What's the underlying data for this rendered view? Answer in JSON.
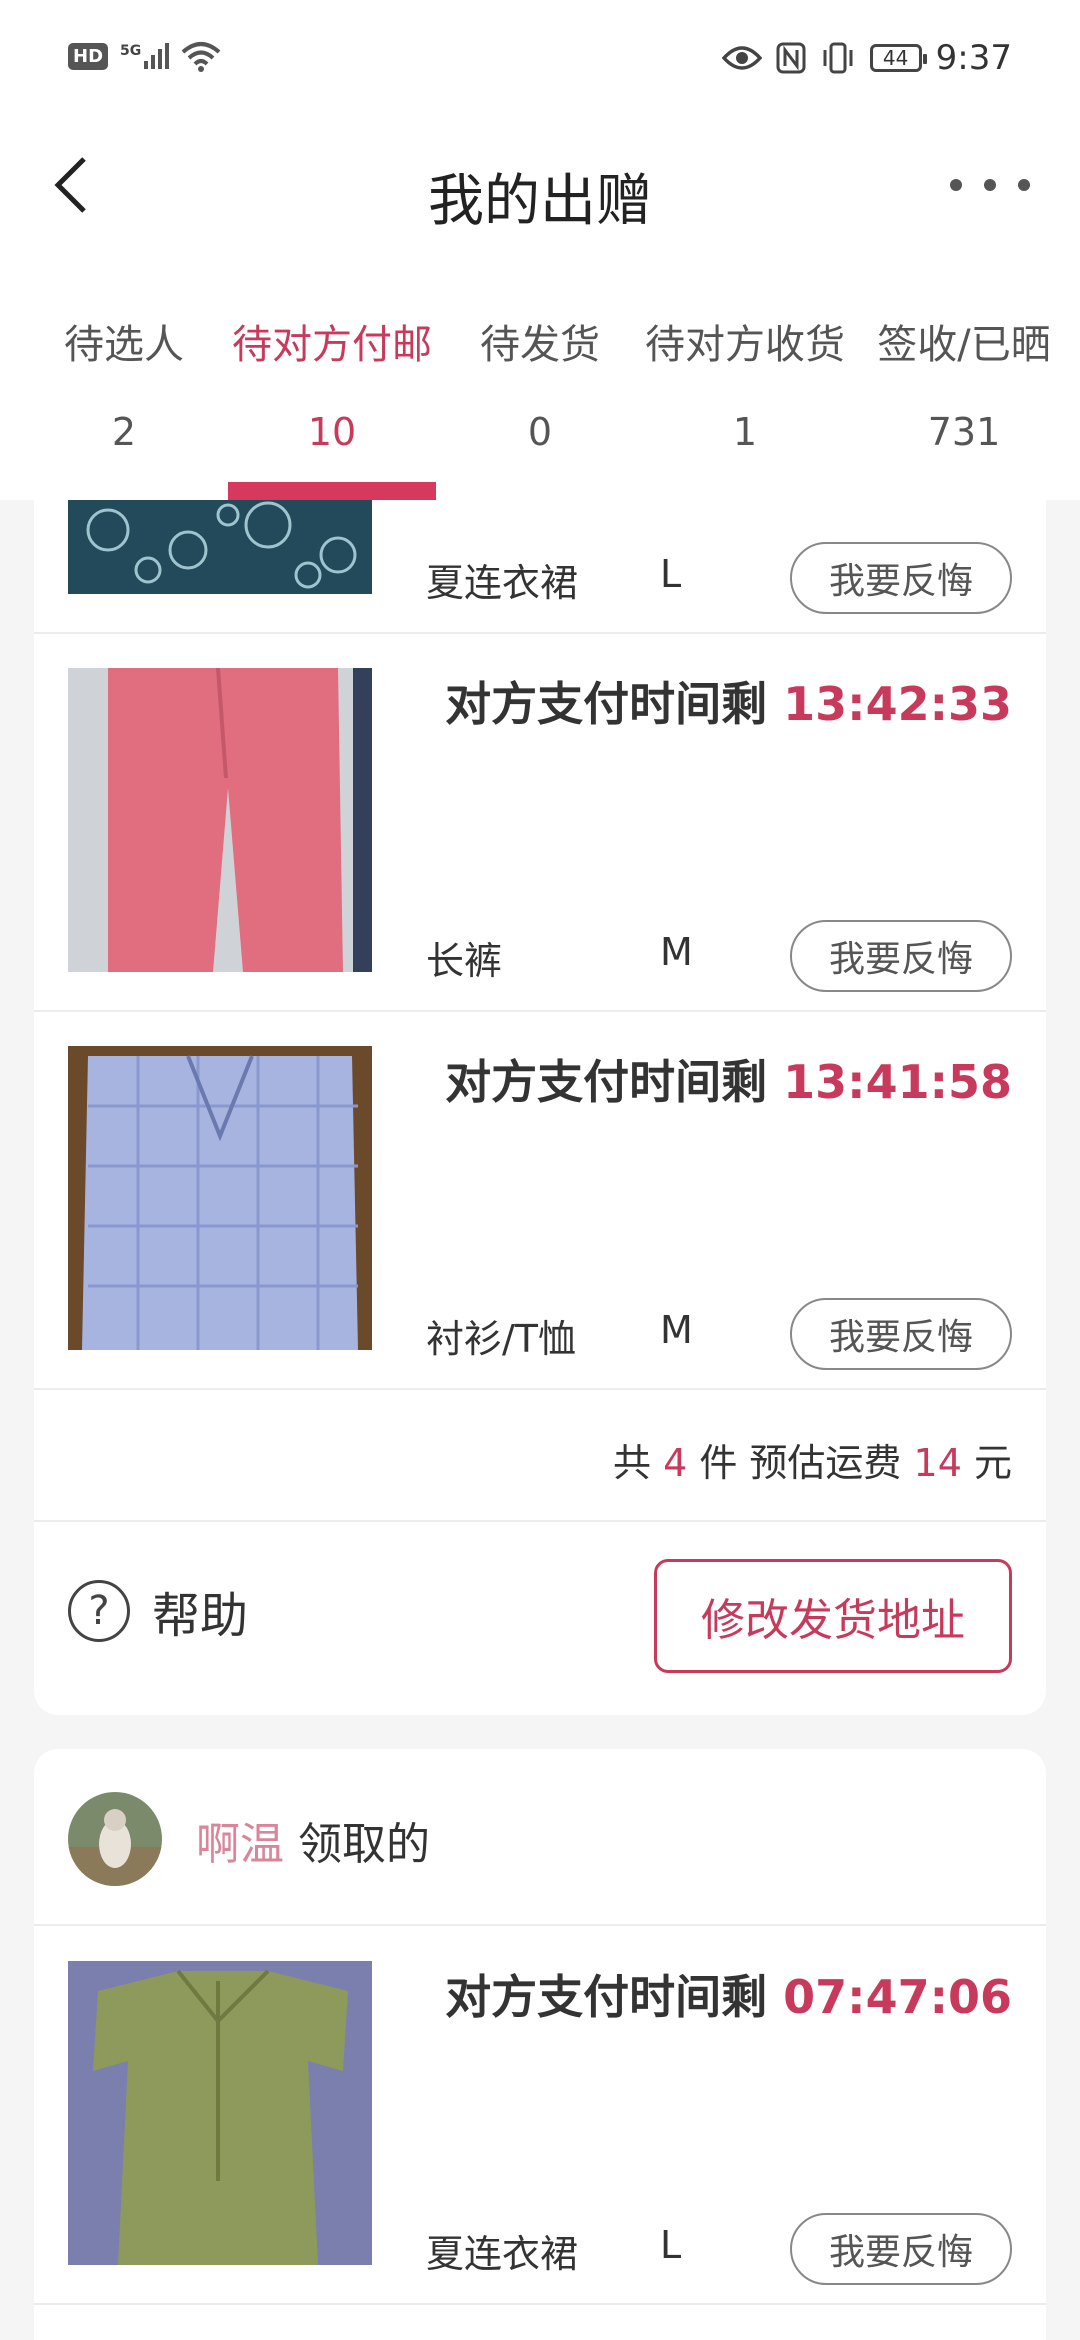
{
  "status_bar": {
    "hd": "HD",
    "network": "5G",
    "battery": "44",
    "time": "9:37"
  },
  "nav": {
    "title": "我的出赠"
  },
  "tabs": [
    {
      "label": "待选人",
      "count": "2"
    },
    {
      "label": "待对方付邮",
      "count": "10"
    },
    {
      "label": "待发货",
      "count": "0"
    },
    {
      "label": "待对方收货",
      "count": "1"
    },
    {
      "label": "签收/已晒",
      "count": "731"
    }
  ],
  "active_tab_index": 1,
  "timer_prefix": "对方支付时间剩",
  "regret_label": "我要反悔",
  "group1": {
    "items": [
      {
        "name": "夏连衣裙",
        "size": "L"
      },
      {
        "name": "长裤",
        "size": "M",
        "time": "13:42:33"
      },
      {
        "name": "衬衫/T恤",
        "size": "M",
        "time": "13:41:58"
      }
    ],
    "summary": {
      "prefix": "共",
      "count": "4",
      "unit": "件 预估运费",
      "fee": "14",
      "currency": "元"
    },
    "help_label": "帮助",
    "address_button": "修改发货地址"
  },
  "group2": {
    "user_name": "啊温",
    "user_suffix": "领取的",
    "items": [
      {
        "name": "夏连衣裙",
        "size": "L",
        "time": "07:47:06"
      }
    ]
  },
  "colors": {
    "accent": "#c83a5c",
    "indicator": "#d7385e",
    "username": "#d9869a",
    "background": "#f5f5f5"
  }
}
